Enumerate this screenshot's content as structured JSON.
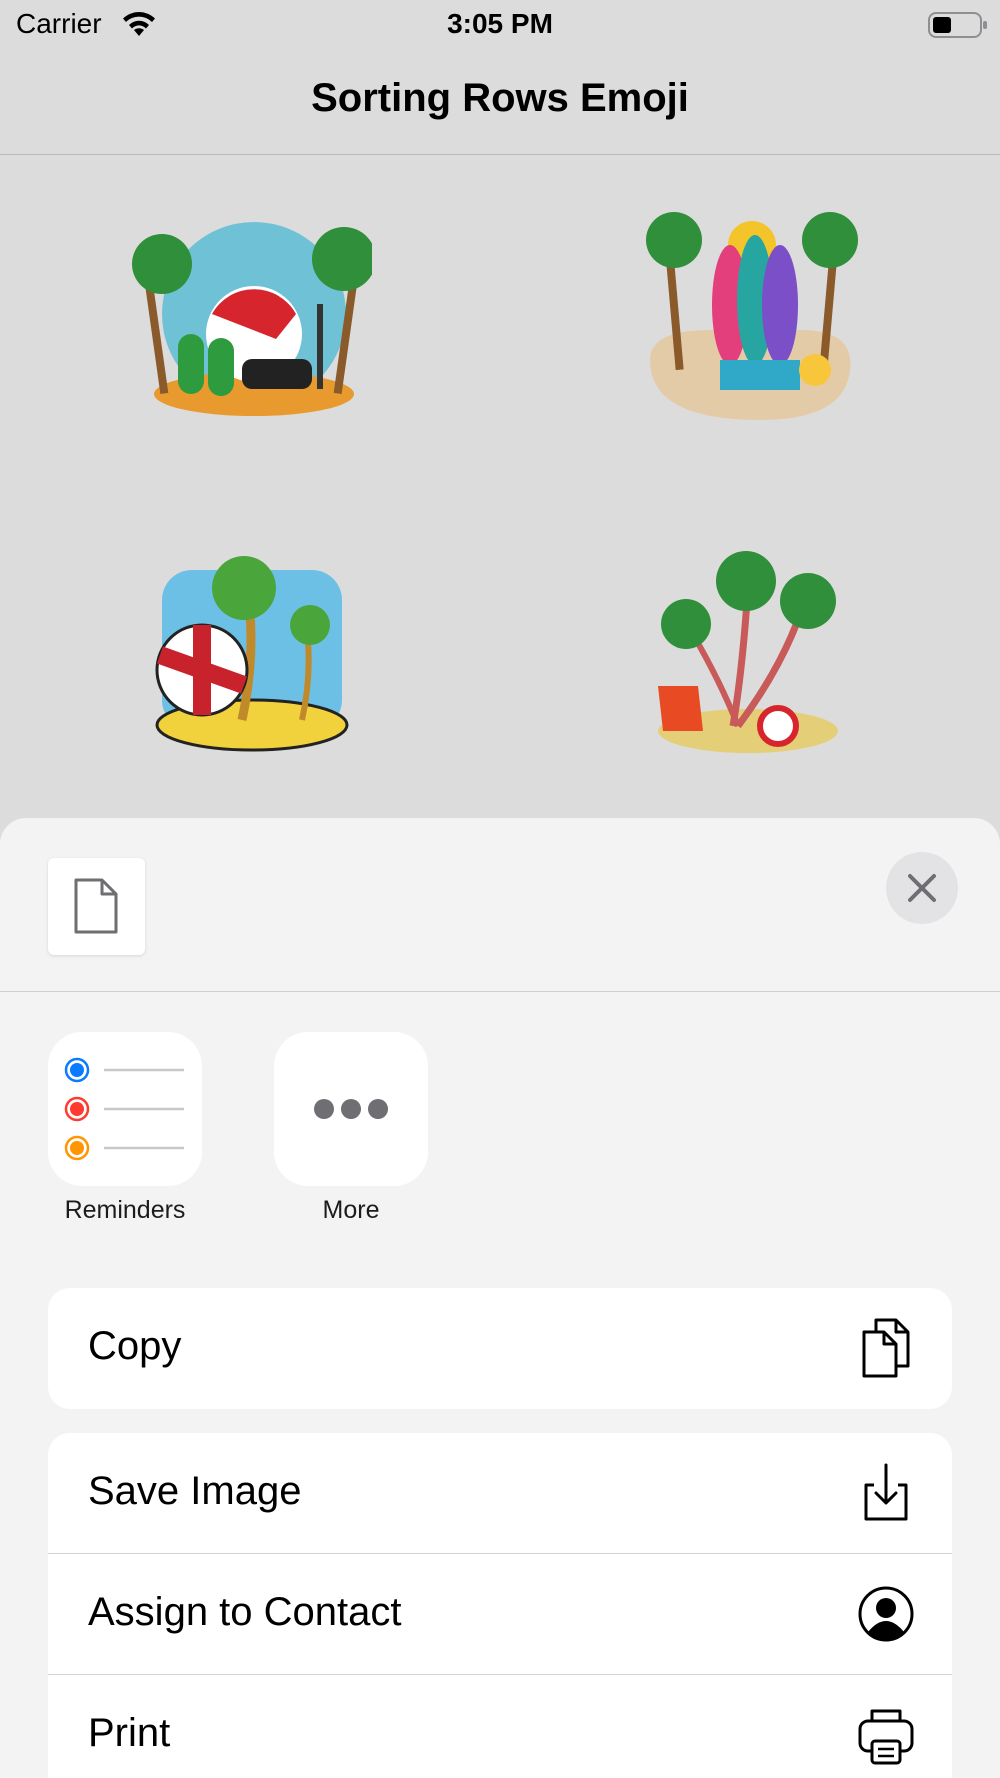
{
  "status_bar": {
    "carrier": "Carrier",
    "time": "3:05 PM"
  },
  "nav": {
    "title": "Sorting Rows Emoji"
  },
  "stickers": [
    {
      "name": "beach-ball-flipflops-sticker"
    },
    {
      "name": "surfboards-island-sticker"
    },
    {
      "name": "beach-ball-palm-sticker"
    },
    {
      "name": "palms-lounge-chair-sticker"
    }
  ],
  "share_sheet": {
    "document_icon": "document-icon",
    "close_icon": "close-icon",
    "apps": [
      {
        "label": "Reminders",
        "icon": "reminders-icon"
      },
      {
        "label": "More",
        "icon": "more-icon"
      }
    ],
    "actions": [
      {
        "label": "Copy",
        "icon": "copy-icon"
      },
      {
        "label": "Save Image",
        "icon": "save-image-icon"
      },
      {
        "label": "Assign to Contact",
        "icon": "contact-icon"
      },
      {
        "label": "Print",
        "icon": "print-icon"
      }
    ]
  },
  "colors": {
    "background": "#dcdcdc",
    "sheet_background": "#f3f3f3",
    "reminder_blue": "#0a7aff",
    "reminder_red": "#ff3b30",
    "reminder_orange": "#ff9500"
  }
}
